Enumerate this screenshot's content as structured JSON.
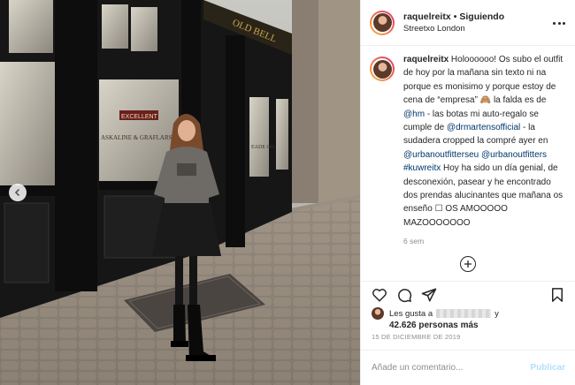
{
  "post": {
    "username": "raquelreitx",
    "follow_status": "Siguiendo",
    "location": "Streetxo London"
  },
  "caption": {
    "username": "raquelreitx",
    "part1": " Holoooooo! Os subo el outfit de hoy por la mañana sin texto ni na porque es monisimo y porque estoy de cena de “empresa” 🙈 la falda es de ",
    "mention_hm": "@hm",
    "part2": " - las botas mi auto-regalo se cumple de ",
    "mention_drmartens": "@drmartensofficial",
    "part3": " - la sudadera cropped la compré ayer en ",
    "mention_uoeu": "@urbanoutfitterseu",
    "mention_uo": "@urbanoutfitters",
    "hashtag": "#kuwreitx",
    "part4": " Hoy ha sido un día genial, de desconexión, pasear y he encontrado dos prendas alucinantes que mañana os enseño ☐ OS AMOOOOO MAZOOOOOOO",
    "time_ago": "6 sem"
  },
  "photo": {
    "sign_excellent": "EXCELLENT",
    "sign_shop": "ASKALINE & GRAFLARS",
    "sign_fade": "EADE OD",
    "fascia": "OLD BELL"
  },
  "likes": {
    "prefix": "Les gusta a",
    "suffix": "y",
    "count": "42.626 personas más"
  },
  "date": "15 DE DICIEMBRE DE 2019",
  "comment": {
    "placeholder": "Añade un comentario...",
    "publish": "Publicar"
  },
  "icons": {
    "more": "more-icon",
    "like": "heart-icon",
    "comment": "comment-icon",
    "share": "share-icon",
    "save": "bookmark-icon",
    "load_more": "plus-circle-icon",
    "prev": "chevron-left-icon"
  },
  "colors": {
    "link": "#00376b",
    "muted": "#8e8e8e",
    "publish_disabled": "#b2dffc",
    "storefront": "#161616"
  }
}
